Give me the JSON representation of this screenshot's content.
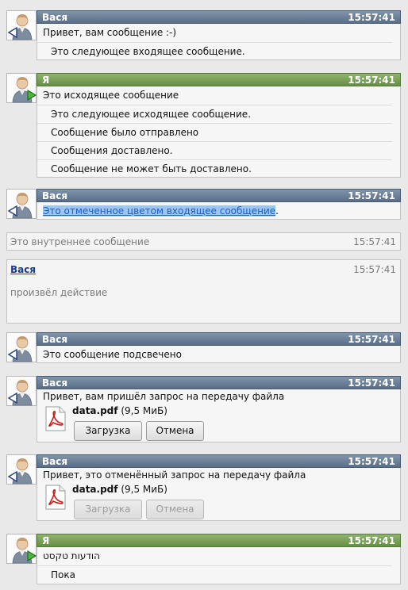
{
  "messages": [
    {
      "sender": "Вася",
      "time": "15:57:41",
      "lines": [
        "Привет, вам сообщение :-)",
        "Это следующее входящее сообщение."
      ]
    },
    {
      "sender": "Я",
      "time": "15:57:41",
      "lines": [
        "Это исходящее сообщение",
        "Это следующее исходящее сообщение.",
        "Сообщение было отправлено",
        "Сообщения доставлено.",
        "Сообщение не может быть доставлено."
      ]
    },
    {
      "sender": "Вася",
      "time": "15:57:41",
      "highlighted_text": "Это отмеченное цветом входящее сообщение",
      "highlighted_tail": "."
    },
    {
      "internal_text": "Это внутреннее сообщение",
      "time": "15:57:41"
    },
    {
      "action_sender": "Вася",
      "action_text": "произвёл действие",
      "time": "15:57:41"
    },
    {
      "sender": "Вася",
      "time": "15:57:41",
      "lines": [
        "Это сообщение подсвечено"
      ]
    },
    {
      "sender": "Вася",
      "time": "15:57:41",
      "text": "Привет, вам пришёл запрос на передачу файла",
      "file_name": "data.pdf",
      "file_size": "(9,5 МиБ)",
      "download_label": "Загрузка",
      "cancel_label": "Отмена"
    },
    {
      "sender": "Вася",
      "time": "15:57:41",
      "text": "Привет, это отменённый запрос на передачу файла",
      "file_name": "data.pdf",
      "file_size": "(9,5 МиБ)",
      "download_label": "Загрузка",
      "cancel_label": "Отмена"
    },
    {
      "sender": "Я",
      "time": "15:57:41",
      "lines": [
        "הודעות טקסט",
        "Пока"
      ]
    }
  ],
  "icons": {
    "avatar": "user-avatar-icon",
    "incoming": "incoming-arrow-icon",
    "outgoing": "outgoing-arrow-icon",
    "file": "pdf-file-icon"
  },
  "colors": {
    "incoming_header": "#5a6f87",
    "outgoing_header": "#668f45",
    "highlight": "#6aa6e6"
  }
}
